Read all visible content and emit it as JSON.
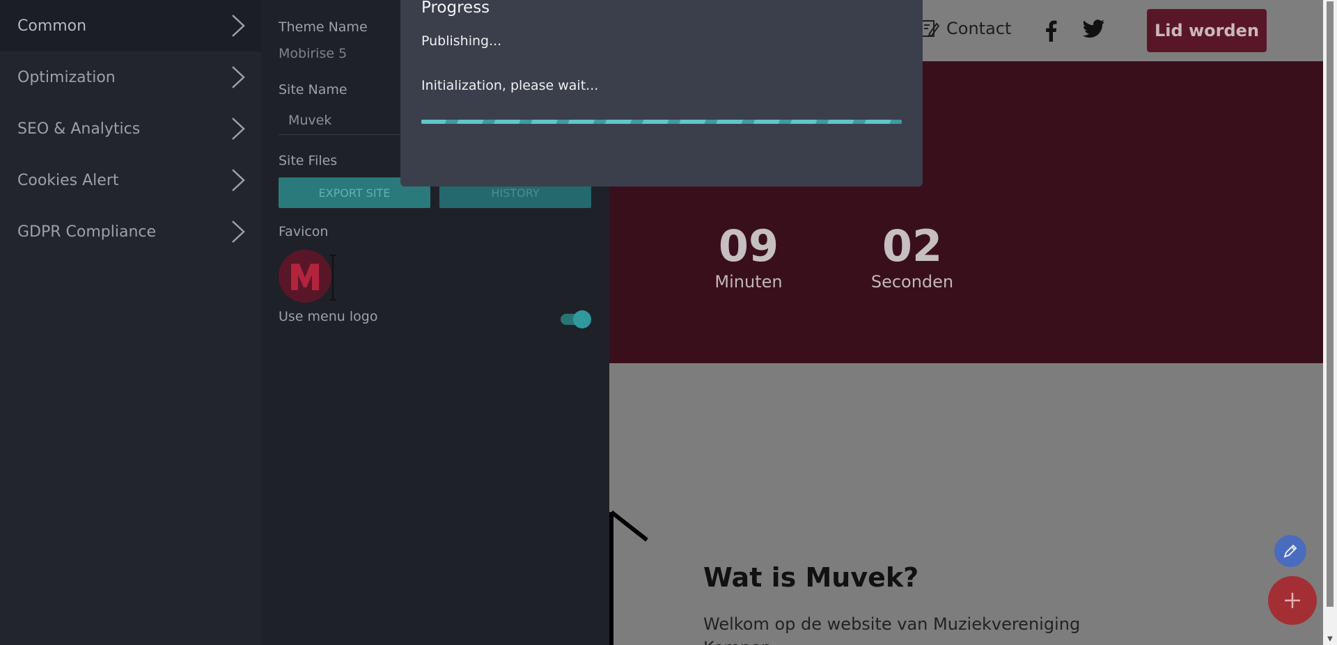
{
  "nav": {
    "items": [
      {
        "label": "Common"
      },
      {
        "label": "Optimization"
      },
      {
        "label": "SEO & Analytics"
      },
      {
        "label": "Cookies Alert"
      },
      {
        "label": "GDPR Compliance"
      }
    ]
  },
  "panel": {
    "theme_name_label": "Theme Name",
    "theme_name_value": "Mobirise 5",
    "site_name_label": "Site Name",
    "site_name_value": "Muvek",
    "site_files_label": "Site Files",
    "export_label": "EXPORT SITE",
    "history_label": "HISTORY",
    "favicon_label": "Favicon",
    "use_menu_logo_label": "Use menu logo",
    "use_menu_logo_on": true
  },
  "modal": {
    "title": "Progress",
    "status": "Publishing...",
    "message": "Initialization, please wait..."
  },
  "site": {
    "contact_label": "Contact",
    "cta_label": "Lid worden",
    "countdown": [
      {
        "num": "09",
        "unit": "Minuten"
      },
      {
        "num": "02",
        "unit": "Seconden"
      }
    ],
    "about_title": "Wat is Muvek?",
    "about_text": "Welkom op de website van Muziekvereniging Kempen"
  },
  "colors": {
    "accent": "#2a7a7c",
    "brand": "#5a1629",
    "hero": "#3a0f1c",
    "fab_add": "#a32f35",
    "fab_edit": "#4a6cbf"
  }
}
